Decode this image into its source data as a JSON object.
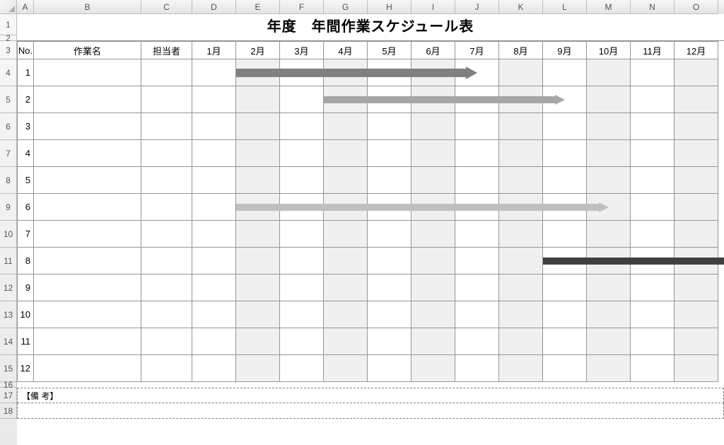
{
  "columns": [
    "A",
    "B",
    "C",
    "D",
    "E",
    "F",
    "G",
    "H",
    "I",
    "J",
    "K",
    "L",
    "M",
    "N",
    "O"
  ],
  "rowNumbers": [
    "1",
    "2",
    "3",
    "4",
    "5",
    "6",
    "7",
    "8",
    "9",
    "10",
    "11",
    "12",
    "13",
    "14",
    "15",
    "16",
    "17",
    "18"
  ],
  "title": "年度　年間作業スケジュール表",
  "headers": {
    "no": "No.",
    "task": "作業名",
    "owner": "担当者",
    "months": [
      "1月",
      "2月",
      "3月",
      "4月",
      "5月",
      "6月",
      "7月",
      "8月",
      "9月",
      "10月",
      "11月",
      "12月"
    ]
  },
  "shadedMonthIndices": [
    1,
    3,
    5,
    7,
    9,
    11
  ],
  "tasks": [
    {
      "no": "1"
    },
    {
      "no": "2"
    },
    {
      "no": "3"
    },
    {
      "no": "4"
    },
    {
      "no": "5"
    },
    {
      "no": "6"
    },
    {
      "no": "7"
    },
    {
      "no": "8"
    },
    {
      "no": "9"
    },
    {
      "no": "10"
    },
    {
      "no": "11"
    },
    {
      "no": "12"
    }
  ],
  "arrows": [
    {
      "rowIndex": 0,
      "startMonthIndex": 1,
      "endMonthFraction": 6.5,
      "color": "#808080",
      "big": true
    },
    {
      "rowIndex": 1,
      "startMonthIndex": 3,
      "endMonthFraction": 8.5,
      "color": "#a6a6a6",
      "big": false
    },
    {
      "rowIndex": 5,
      "startMonthIndex": 1,
      "endMonthFraction": 9.5,
      "color": "#bfbfbf",
      "big": false
    },
    {
      "rowIndex": 7,
      "startMonthIndex": 8,
      "endMonthFraction": 12.4,
      "color": "#404040",
      "big": false
    }
  ],
  "remarksLabel": "【備 考】"
}
